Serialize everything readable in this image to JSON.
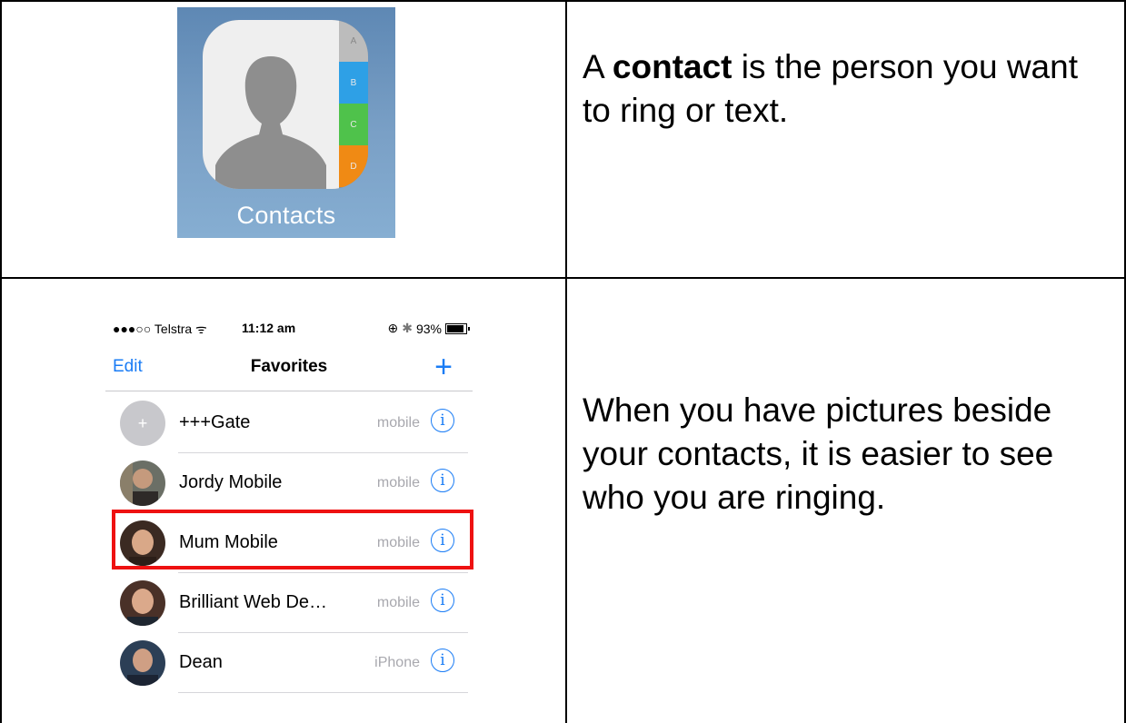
{
  "row1": {
    "icon": {
      "tabs": [
        "A",
        "B",
        "C",
        "D"
      ],
      "label": "Contacts"
    },
    "text": {
      "prefix": "A ",
      "bold": "contact",
      "suffix": " is the person you want to ring or text."
    }
  },
  "row2": {
    "phone": {
      "status": {
        "carrier": "●●●○○ Telstra",
        "time": "11:12 am",
        "battery": "93%"
      },
      "nav": {
        "edit": "Edit",
        "title": "Favorites",
        "add": "+"
      },
      "contacts": [
        {
          "name": "+++Gate",
          "type": "mobile",
          "avatar": "plus-avatar"
        },
        {
          "name": "Jordy Mobile",
          "type": "mobile",
          "avatar": "photo"
        },
        {
          "name": "Mum Mobile",
          "type": "mobile",
          "avatar": "photo",
          "highlighted": true
        },
        {
          "name": "Brilliant Web De…",
          "type": "mobile",
          "avatar": "photo"
        },
        {
          "name": "Dean",
          "type": "iPhone",
          "avatar": "photo"
        }
      ],
      "info_glyph": "i",
      "highlight_color": "#ee1111",
      "accent_color": "#1a7cf5"
    },
    "text": "When you have pictures beside your contacts, it is easier to see who you are ringing."
  }
}
